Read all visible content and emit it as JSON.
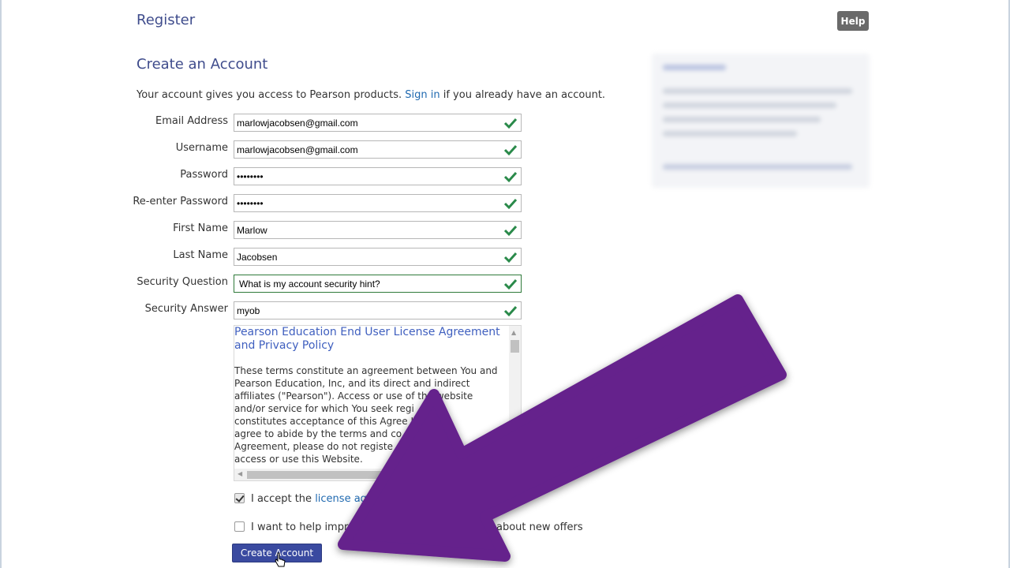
{
  "header": {
    "title": "Register",
    "help_label": "Help"
  },
  "form": {
    "title": "Create an Account",
    "intro_before": "Your account gives you access to Pearson products.",
    "intro_link": "Sign in",
    "intro_after": "if you already have an account.",
    "fields": [
      {
        "label": "Email Address",
        "value": "marlowjacobsen@gmail.com"
      },
      {
        "label": "Username",
        "value": "marlowjacobsen@gmail.com"
      },
      {
        "label": "Password",
        "value": "••••••••"
      },
      {
        "label": "Re-enter Password",
        "value": "••••••••"
      },
      {
        "label": "First Name",
        "value": "Marlow"
      },
      {
        "label": "Last Name",
        "value": "Jacobsen"
      },
      {
        "label": "Security Question",
        "value": "What is my account security hint?"
      },
      {
        "label": "Security Answer",
        "value": "myob"
      }
    ]
  },
  "license": {
    "title": "Pearson Education End User License Agreement and Privacy Policy",
    "text": "These terms constitute an agreement between You and\nPearson Education, Inc, and its direct and indirect\naffiliates (\"Pearson\"). Access or use of the website\nand/or service for which You seek regi\nconstitutes acceptance of this Agree    If Yo\nagree to abide by the terms and co\nAgreement, please do not registe\naccess or use this Website."
  },
  "checkboxes": {
    "accept_prefix": "I accept the",
    "accept_link": "license ag",
    "accept_checked": true,
    "offers_before": "I want to help impr",
    "offers_after": "about new offers",
    "offers_checked": false
  },
  "actions": {
    "create_label": "Create Account"
  },
  "colors": {
    "accent": "#3f4c8c",
    "link": "#1f69b0",
    "check": "#2a8a4a",
    "button": "#3a4aa0",
    "arrow": "#65218c"
  },
  "icons": {
    "field_status": "check-icon",
    "cursor": "hand-cursor-icon",
    "overlay": "arrow-overlay"
  }
}
